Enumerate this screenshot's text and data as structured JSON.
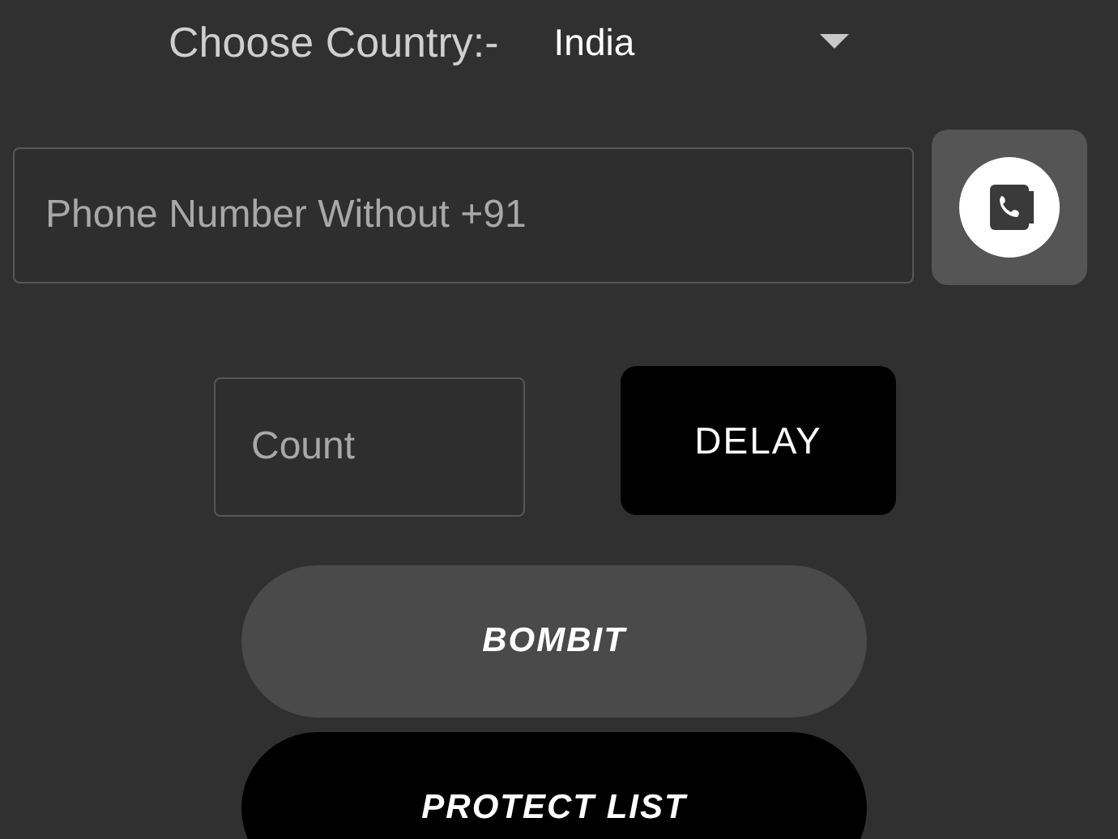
{
  "country_picker": {
    "label": "Choose Country:-",
    "value": "India"
  },
  "phone_field": {
    "placeholder": "Phone Number Without +91"
  },
  "count_field": {
    "placeholder": "Count"
  },
  "buttons": [
    {
      "label": "DELAY",
      "kind": "delay"
    },
    {
      "label": "BOMBIT",
      "kind": "primary"
    },
    {
      "label": "PROTECT LIST",
      "kind": "dark"
    }
  ]
}
